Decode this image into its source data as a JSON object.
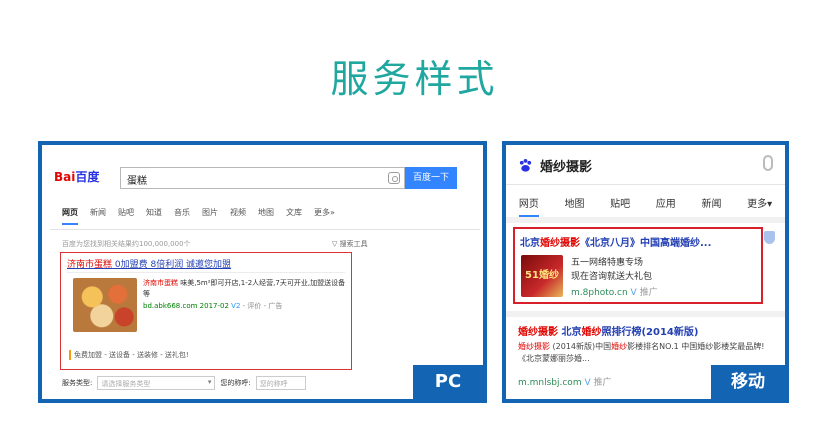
{
  "title": "服务样式",
  "pc": {
    "logo_red": "Bai",
    "logo_blue": "百度",
    "search_value": "蛋糕",
    "search_button": "百度一下",
    "tabs": [
      "网页",
      "新闻",
      "贴吧",
      "知道",
      "音乐",
      "图片",
      "视频",
      "地图",
      "文库",
      "更多»"
    ],
    "result_count": "百度为您找到相关结果约100,000,000个",
    "search_tools": "搜索工具",
    "result": {
      "title_hl": "济南市蛋糕",
      "title_rest": " 0加盟费 8倍利润 诚邀您加盟",
      "desc_hl": "济南市蛋糕",
      "desc_rest": " 味美,5m²即可开店,1-2人经营,7天可开业,加盟送设备等",
      "url": "bd.abk668.com 2017-02",
      "url_v": "V2",
      "url_tail": "- 评价 - 广告",
      "links": "免费加盟 - 送设备 - 送装修 - 送礼包!"
    },
    "form": {
      "service_label": "服务类型:",
      "service_placeholder": "请选择服务类型",
      "phone_label": "您的称呼:",
      "phone_placeholder": "您的称呼"
    },
    "badge": "PC"
  },
  "mobile": {
    "query": "婚纱摄影",
    "tabs": [
      "网页",
      "地图",
      "贴吧",
      "应用",
      "新闻",
      "更多▾"
    ],
    "card1": {
      "title_pre": "北京",
      "title_hl": "婚纱摄影",
      "title_rest": "《北京八月》中国高端婚纱...",
      "img_text": "51婚纱",
      "line1": "五一网络特惠专场",
      "line2": "现在咨询就送大礼包",
      "url": "m.8photo.cn",
      "url_v": "V",
      "url_tail": "推广"
    },
    "card2": {
      "title_hl1": "婚纱摄影",
      "title_mid": " 北京",
      "title_hl2": "婚纱",
      "title_rest": "照排行榜(2014新版)",
      "desc_hl1": "婚纱摄影",
      "desc_mid": " (2014新版)中国",
      "desc_hl2": "婚纱",
      "desc_rest": "影楼排名NO.1 中国婚纱影楼奖最品牌!《北京蒙娜丽莎婚...",
      "url": "m.mnlsbj.com",
      "url_v": "V",
      "url_tail": "推广"
    },
    "badge": "移动"
  },
  "colors": {
    "title": "#1fa7a0",
    "frame": "#1464b4",
    "highlight_border": "#e03030",
    "link": "#2440b3",
    "keyword": "#e10602"
  }
}
